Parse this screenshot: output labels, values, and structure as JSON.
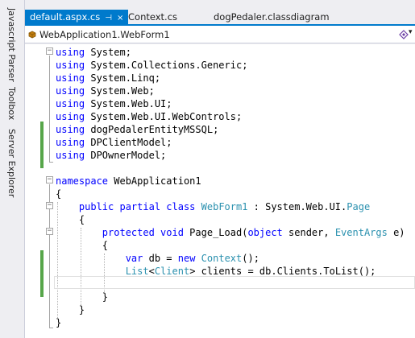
{
  "side_tabs": [
    "Javascript Parser",
    "Toolbox",
    "Server Explorer"
  ],
  "tabs": [
    {
      "label": "default.aspx.cs",
      "pin": "⊣",
      "close": "×",
      "active": true
    },
    {
      "label": "Context.cs",
      "active": false
    },
    {
      "label": "dogPedaler.classdiagram",
      "active": false
    }
  ],
  "nav": {
    "selected": "WebApplication1.WebForm1"
  },
  "colors": {
    "keyword": "#0000ff",
    "type": "#2b91af",
    "accent": "#007acc",
    "change_marker": "#57a64a"
  },
  "code": [
    {
      "segs": [
        [
          "kw",
          "using"
        ],
        [
          "",
          "System;"
        ]
      ]
    },
    {
      "segs": [
        [
          "kw",
          "using"
        ],
        [
          "",
          "System.Collections.Generic;"
        ]
      ]
    },
    {
      "segs": [
        [
          "kw",
          "using"
        ],
        [
          "",
          "System.Linq;"
        ]
      ]
    },
    {
      "segs": [
        [
          "kw",
          "using"
        ],
        [
          "",
          "System.Web;"
        ]
      ]
    },
    {
      "segs": [
        [
          "kw",
          "using"
        ],
        [
          "",
          "System.Web.UI;"
        ]
      ]
    },
    {
      "segs": [
        [
          "kw",
          "using"
        ],
        [
          "",
          "System.Web.UI.WebControls;"
        ]
      ]
    },
    {
      "segs": [
        [
          "kw",
          "using"
        ],
        [
          "",
          "dogPedalerEntityMSSQL;"
        ]
      ]
    },
    {
      "segs": [
        [
          "kw",
          "using"
        ],
        [
          "",
          "DPClientModel;"
        ]
      ]
    },
    {
      "segs": [
        [
          "kw",
          "using"
        ],
        [
          "",
          "DPOwnerModel;"
        ]
      ]
    },
    {
      "segs": []
    },
    {
      "segs": [
        [
          "kw",
          "namespace"
        ],
        [
          "",
          " WebApplication1"
        ]
      ]
    },
    {
      "segs": [
        [
          "",
          "{"
        ]
      ]
    },
    {
      "segs": [
        [
          "",
          "    "
        ],
        [
          "kw",
          "public partial class"
        ],
        [
          "",
          " "
        ],
        [
          "ty",
          "WebForm1"
        ],
        [
          "",
          " : System.Web.UI."
        ],
        [
          "ty",
          "Page"
        ]
      ]
    },
    {
      "segs": [
        [
          "",
          "    {"
        ]
      ]
    },
    {
      "segs": [
        [
          "",
          "        "
        ],
        [
          "kw",
          "protected void"
        ],
        [
          "",
          " Page_Load("
        ],
        [
          "kw",
          "object"
        ],
        [
          "",
          " sender, "
        ],
        [
          "ty",
          "EventArgs"
        ],
        [
          "",
          " e)"
        ]
      ]
    },
    {
      "segs": [
        [
          "",
          "        {"
        ]
      ]
    },
    {
      "segs": [
        [
          "",
          "            "
        ],
        [
          "kw",
          "var"
        ],
        [
          "",
          " db = "
        ],
        [
          "kw",
          "new"
        ],
        [
          "",
          " "
        ],
        [
          "ty",
          "Context"
        ],
        [
          "",
          "();"
        ]
      ]
    },
    {
      "segs": [
        [
          "",
          "            "
        ],
        [
          "ty",
          "List"
        ],
        [
          "",
          "<"
        ],
        [
          "ty",
          "Client"
        ],
        [
          "",
          "> clients = db.Clients.ToList();"
        ]
      ]
    },
    {
      "segs": []
    },
    {
      "segs": [
        [
          "",
          "        }"
        ]
      ]
    },
    {
      "segs": [
        [
          "",
          "    }"
        ]
      ]
    },
    {
      "segs": [
        [
          "",
          "}"
        ]
      ]
    }
  ]
}
